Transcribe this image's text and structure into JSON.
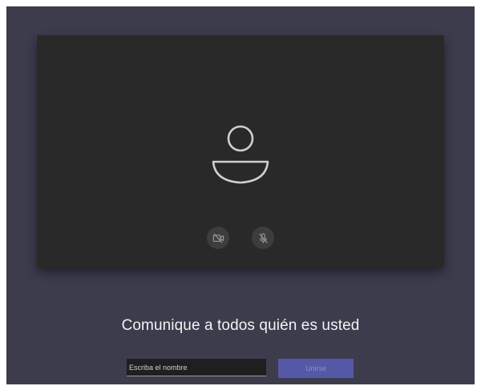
{
  "prompt": {
    "title": "Comunique a todos quién es usted"
  },
  "name_field": {
    "value": "",
    "placeholder": "Escriba el nombre"
  },
  "join": {
    "label": "Unirse"
  },
  "preview": {
    "camera_icon": "camera-off-icon",
    "mic_icon": "mic-off-icon",
    "avatar_icon": "person-icon"
  },
  "colors": {
    "background": "#3c3c4d",
    "preview": "#292929",
    "accent": "#5458a7"
  }
}
